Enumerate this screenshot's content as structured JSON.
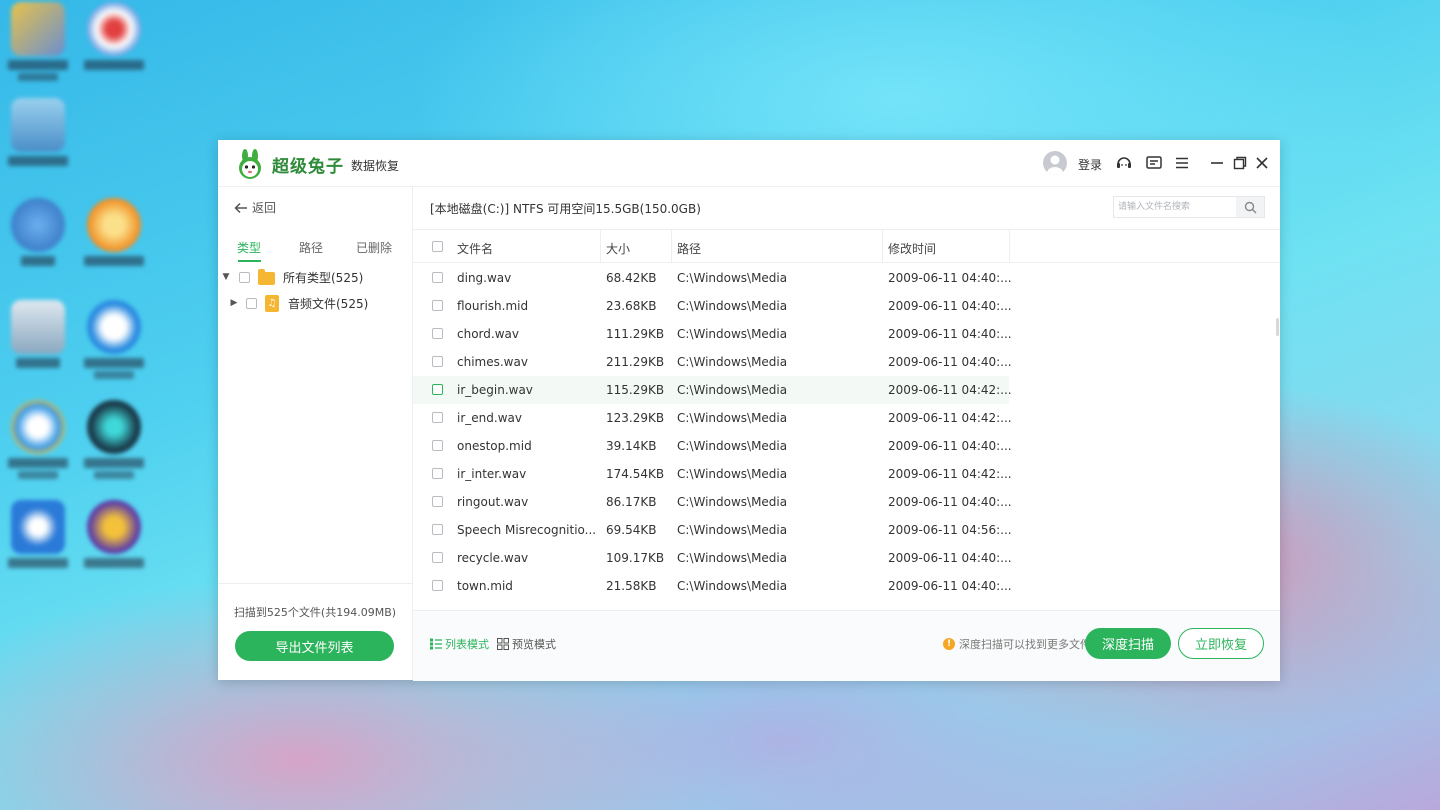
{
  "app": {
    "brand": "超级兔子",
    "brand_sub": "数据恢复",
    "login": "登录"
  },
  "sidebar": {
    "back": "返回",
    "tabs": [
      "类型",
      "路径",
      "已删除"
    ],
    "tree": [
      {
        "label": "所有类型(525)"
      },
      {
        "label": "音频文件(525)"
      }
    ],
    "scan_summary": "扫描到525个文件(共194.09MB)",
    "export_button": "导出文件列表"
  },
  "main": {
    "disk_info": "[本地磁盘(C:)] NTFS 可用空间15.5GB(150.0GB)",
    "search_placeholder": "请输入文件名搜索",
    "columns": {
      "name": "文件名",
      "size": "大小",
      "path": "路径",
      "modified": "修改时间"
    },
    "rows": [
      {
        "name": "ding.wav",
        "size": "68.42KB",
        "path": "C:\\Windows\\Media",
        "modified": "2009-06-11 04:40:..."
      },
      {
        "name": "flourish.mid",
        "size": "23.68KB",
        "path": "C:\\Windows\\Media",
        "modified": "2009-06-11 04:40:..."
      },
      {
        "name": "chord.wav",
        "size": "111.29KB",
        "path": "C:\\Windows\\Media",
        "modified": "2009-06-11 04:40:..."
      },
      {
        "name": "chimes.wav",
        "size": "211.29KB",
        "path": "C:\\Windows\\Media",
        "modified": "2009-06-11 04:40:..."
      },
      {
        "name": "ir_begin.wav",
        "size": "115.29KB",
        "path": "C:\\Windows\\Media",
        "modified": "2009-06-11 04:42:..."
      },
      {
        "name": "ir_end.wav",
        "size": "123.29KB",
        "path": "C:\\Windows\\Media",
        "modified": "2009-06-11 04:42:..."
      },
      {
        "name": "onestop.mid",
        "size": "39.14KB",
        "path": "C:\\Windows\\Media",
        "modified": "2009-06-11 04:40:..."
      },
      {
        "name": "ir_inter.wav",
        "size": "174.54KB",
        "path": "C:\\Windows\\Media",
        "modified": "2009-06-11 04:42:..."
      },
      {
        "name": "ringout.wav",
        "size": "86.17KB",
        "path": "C:\\Windows\\Media",
        "modified": "2009-06-11 04:40:..."
      },
      {
        "name": "Speech Misrecognitio...",
        "size": "69.54KB",
        "path": "C:\\Windows\\Media",
        "modified": "2009-06-11 04:56:..."
      },
      {
        "name": "recycle.wav",
        "size": "109.17KB",
        "path": "C:\\Windows\\Media",
        "modified": "2009-06-11 04:40:..."
      },
      {
        "name": "town.mid",
        "size": "21.58KB",
        "path": "C:\\Windows\\Media",
        "modified": "2009-06-11 04:40:..."
      }
    ],
    "list_mode": "列表模式",
    "preview_mode": "预览模式",
    "deep_scan_hint": "深度扫描可以找到更多文件",
    "deep_scan_button": "深度扫描",
    "recover_button": "立即恢复"
  },
  "colors": {
    "accent": "#2cb45c",
    "warning": "#f5a623",
    "folder": "#f5b731"
  },
  "icons": [
    "logo-rabbit-icon",
    "avatar-icon",
    "support-icon",
    "feedback-icon",
    "menu-icon",
    "minimize-icon",
    "restore-icon",
    "close-icon",
    "back-arrow-icon",
    "folder-icon",
    "audio-file-icon",
    "search-icon",
    "list-mode-icon",
    "preview-mode-icon",
    "warning-icon"
  ]
}
